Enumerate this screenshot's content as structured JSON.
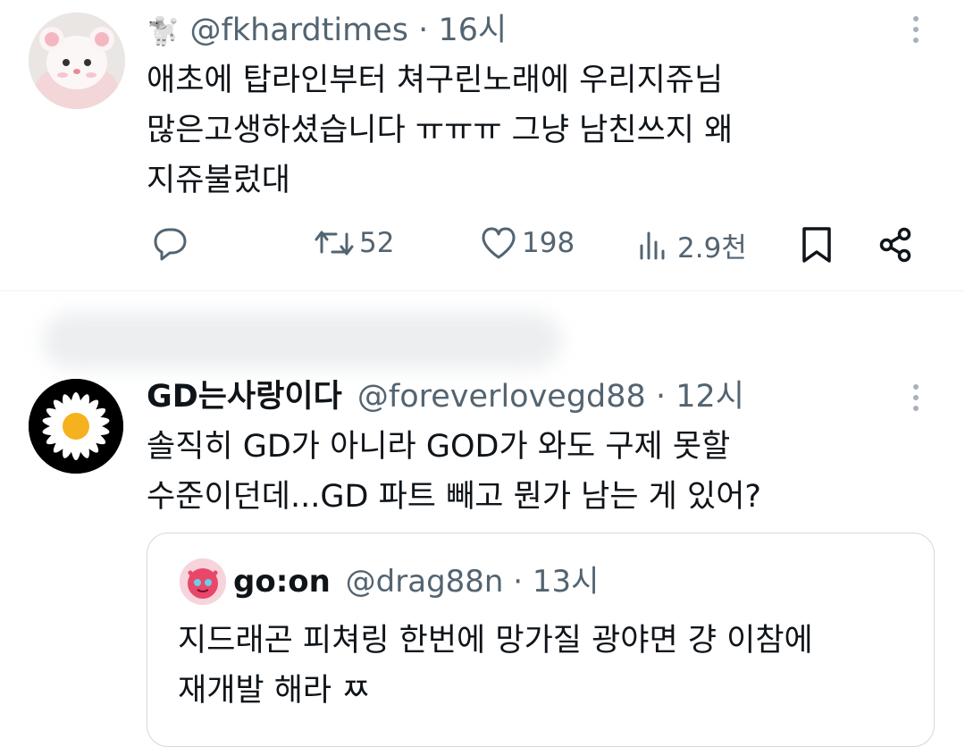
{
  "tweet1": {
    "emoji": "🐩",
    "handle": "@fkhardtimes",
    "separator": "·",
    "time": "16시",
    "lines": [
      "애초에 탑라인부터 쳐구린노래에 우리지쥬님",
      "많은고생하셨습니다 ㅠㅠㅠ 그냥 남친쓰지 왜",
      "지쥬불렀대"
    ],
    "actions": {
      "reply_icon": "reply-icon",
      "retweet_count": "52",
      "like_count": "198",
      "views_count": "2.9천"
    }
  },
  "tweet2": {
    "display_name": "GD는사랑이다",
    "handle": "@foreverlovegd88",
    "separator": "·",
    "time": "12시",
    "lines": [
      "솔직히 GD가 아니라 GOD가 와도 구제 못할",
      "수준이던데...GD 파트 빼고 뭔가 남는 게 있어?"
    ],
    "quote": {
      "display_name": "go:on",
      "handle": "@drag88n",
      "separator": "·",
      "time": "13시",
      "lines": [
        "지드래곤 피쳐링 한번에 망가질 광야면 걍 이참에",
        "재개발 해라 ㅉ"
      ]
    }
  },
  "colors": {
    "text": "#0f1419",
    "muted": "#536471",
    "border": "#cfd9de",
    "divider": "#eff3f4"
  }
}
